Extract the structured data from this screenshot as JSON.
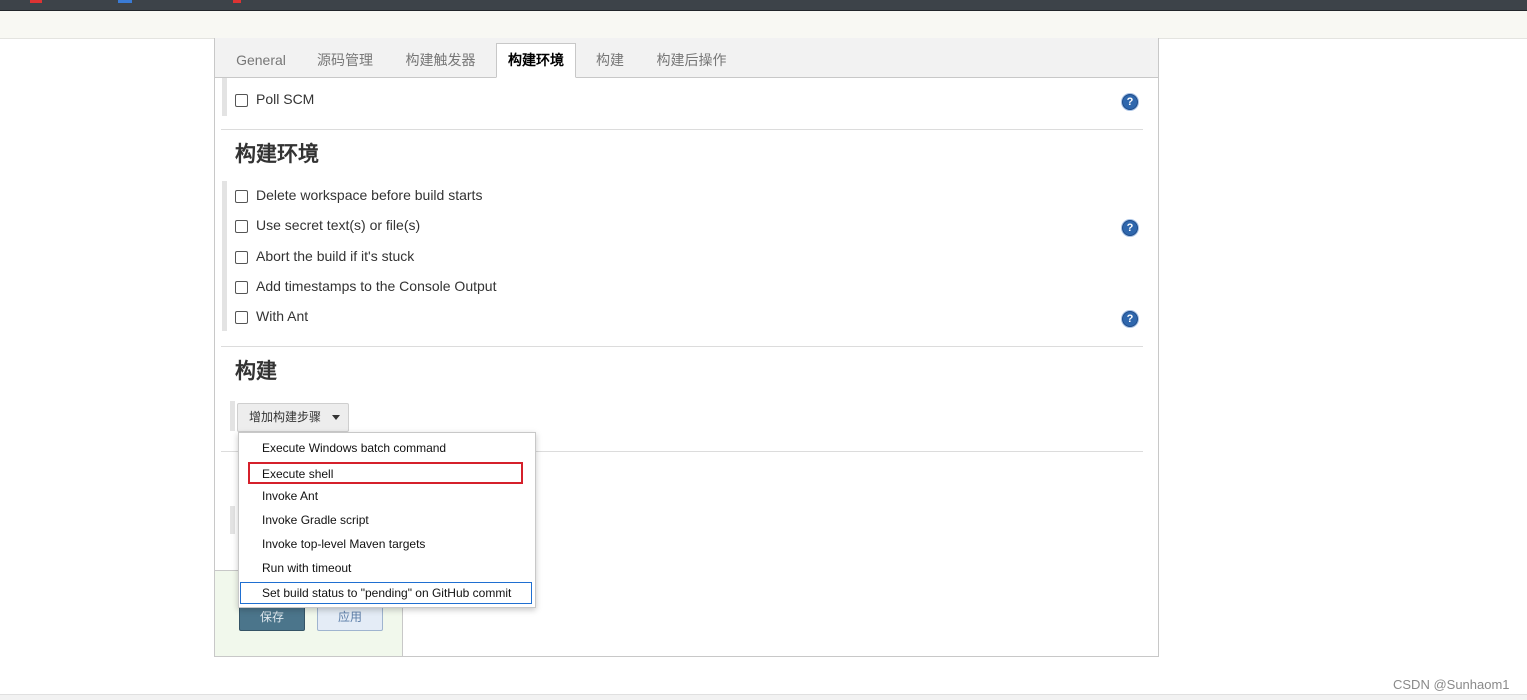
{
  "tabs": [
    {
      "label": "General"
    },
    {
      "label": "源码管理"
    },
    {
      "label": "构建触发器"
    },
    {
      "label": "构建环境"
    },
    {
      "label": "构建"
    },
    {
      "label": "构建后操作"
    }
  ],
  "active_tab": "构建环境",
  "triggers": {
    "poll_scm": {
      "label": "Poll SCM",
      "checked": false
    }
  },
  "build_env": {
    "title": "构建环境",
    "options": [
      {
        "label": "Delete workspace before build starts",
        "checked": false
      },
      {
        "label": "Use secret text(s) or file(s)",
        "checked": false
      },
      {
        "label": "Abort the build if it's stuck",
        "checked": false
      },
      {
        "label": "Add timestamps to the Console Output",
        "checked": false
      },
      {
        "label": "With Ant",
        "checked": false
      }
    ]
  },
  "build": {
    "title": "构建",
    "add_step_label": "增加构建步骤",
    "menu": [
      {
        "label": "Execute Windows batch command"
      },
      {
        "label": "Execute shell",
        "highlighted": true
      },
      {
        "label": "Invoke Ant"
      },
      {
        "label": "Invoke Gradle script"
      },
      {
        "label": "Invoke top-level Maven targets"
      },
      {
        "label": "Run with timeout"
      },
      {
        "label": "Set build status to \"pending\" on GitHub commit",
        "focused": true
      }
    ]
  },
  "buttons": {
    "save": "保存",
    "apply": "应用"
  },
  "help_symbol": "?",
  "watermark": "CSDN @Sunhaom1",
  "colors": {
    "highlight_border": "#d5202b",
    "focus_border": "#1f6fd1",
    "save_button": "#4b758b",
    "help_icon": "#2f67ad"
  }
}
